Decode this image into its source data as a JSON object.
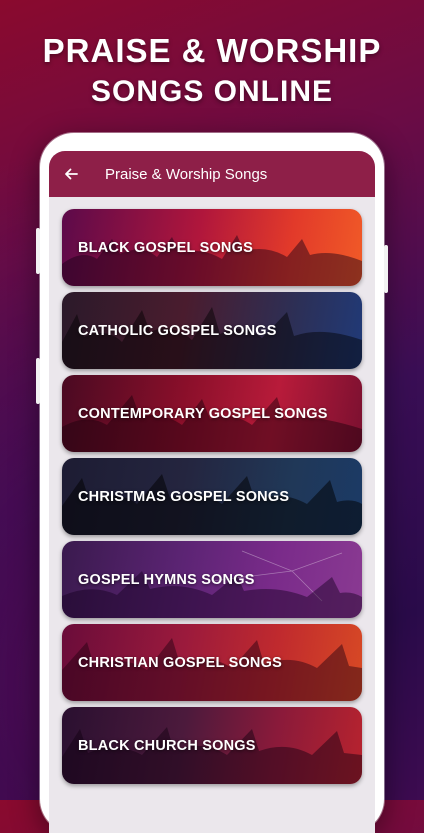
{
  "promo": {
    "line1": "PRAISE & WORSHIP",
    "line2": "SONGS ONLINE"
  },
  "appbar": {
    "back_icon": "arrow-left-icon",
    "title": "Praise & Worship Songs"
  },
  "categories": [
    {
      "label": "BLACK GOSPEL SONGS"
    },
    {
      "label": "CATHOLIC GOSPEL SONGS"
    },
    {
      "label": "CONTEMPORARY GOSPEL SONGS"
    },
    {
      "label": "CHRISTMAS GOSPEL SONGS"
    },
    {
      "label": "GOSPEL HYMNS SONGS"
    },
    {
      "label": "CHRISTIAN GOSPEL SONGS"
    },
    {
      "label": "BLACK CHURCH SONGS"
    }
  ],
  "colors": {
    "appbar": "#8e1f48",
    "screen_bg": "#ebe7ec"
  }
}
